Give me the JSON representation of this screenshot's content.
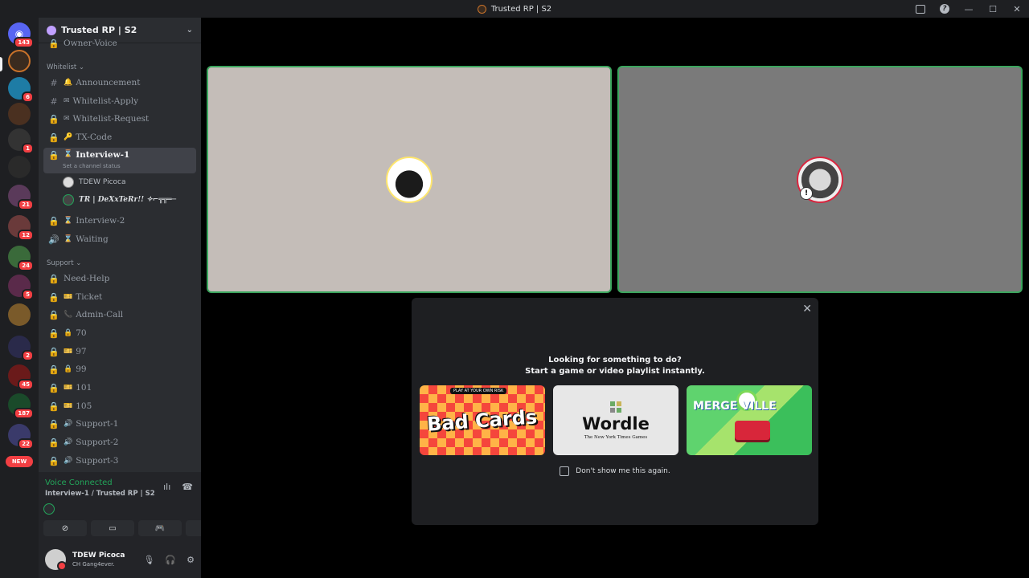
{
  "window": {
    "title": "Trusted RP | S2"
  },
  "rail": {
    "home_badge": "143",
    "badges": [
      "6",
      "1",
      "21",
      "12",
      "24",
      "5",
      "2",
      "45",
      "187",
      "22"
    ],
    "new_label": "NEW"
  },
  "server": {
    "name": "Trusted RP | S2"
  },
  "channels": {
    "top_partial": "Owner-Voice",
    "whitelist_category": "Whitelist",
    "announcement": "Announcement",
    "whitelist_apply": "Whitelist-Apply",
    "whitelist_request": "Whitelist-Request",
    "tx_code": "TX-Code",
    "interview1": "Interview-1",
    "interview1_status": "Set a channel status",
    "voice_users": [
      "TDEW Picoca",
      "TR | DeXxTeRr!! ✧⌐╦╦═─"
    ],
    "interview2": "Interview-2",
    "waiting": "Waiting",
    "support_category": "Support",
    "need_help": "Need-Help",
    "ticket": "Ticket",
    "admin_call": "Admin-Call",
    "c70": "70",
    "c97": "97",
    "c99": "99",
    "c101": "101",
    "c105": "105",
    "support1": "Support-1",
    "support2": "Support-2",
    "support3": "Support-3"
  },
  "voice_panel": {
    "title": "Voice Connected",
    "subtitle": "Interview-1 / Trusted RP | S2"
  },
  "user_panel": {
    "name": "TDEW Picoca",
    "status": "CH Gang4ever."
  },
  "activity": {
    "heading": "Looking for something to do?",
    "subheading": "Start a game or video playlist instantly.",
    "games": [
      {
        "title": "Bad Cards",
        "tag": "PLAY AT YOUR OWN RISK"
      },
      {
        "title": "Wordle",
        "subtitle": "The New York Times Games"
      },
      {
        "title": "MERGE VILLE"
      }
    ],
    "checkbox_label": "Don't show me this again."
  }
}
